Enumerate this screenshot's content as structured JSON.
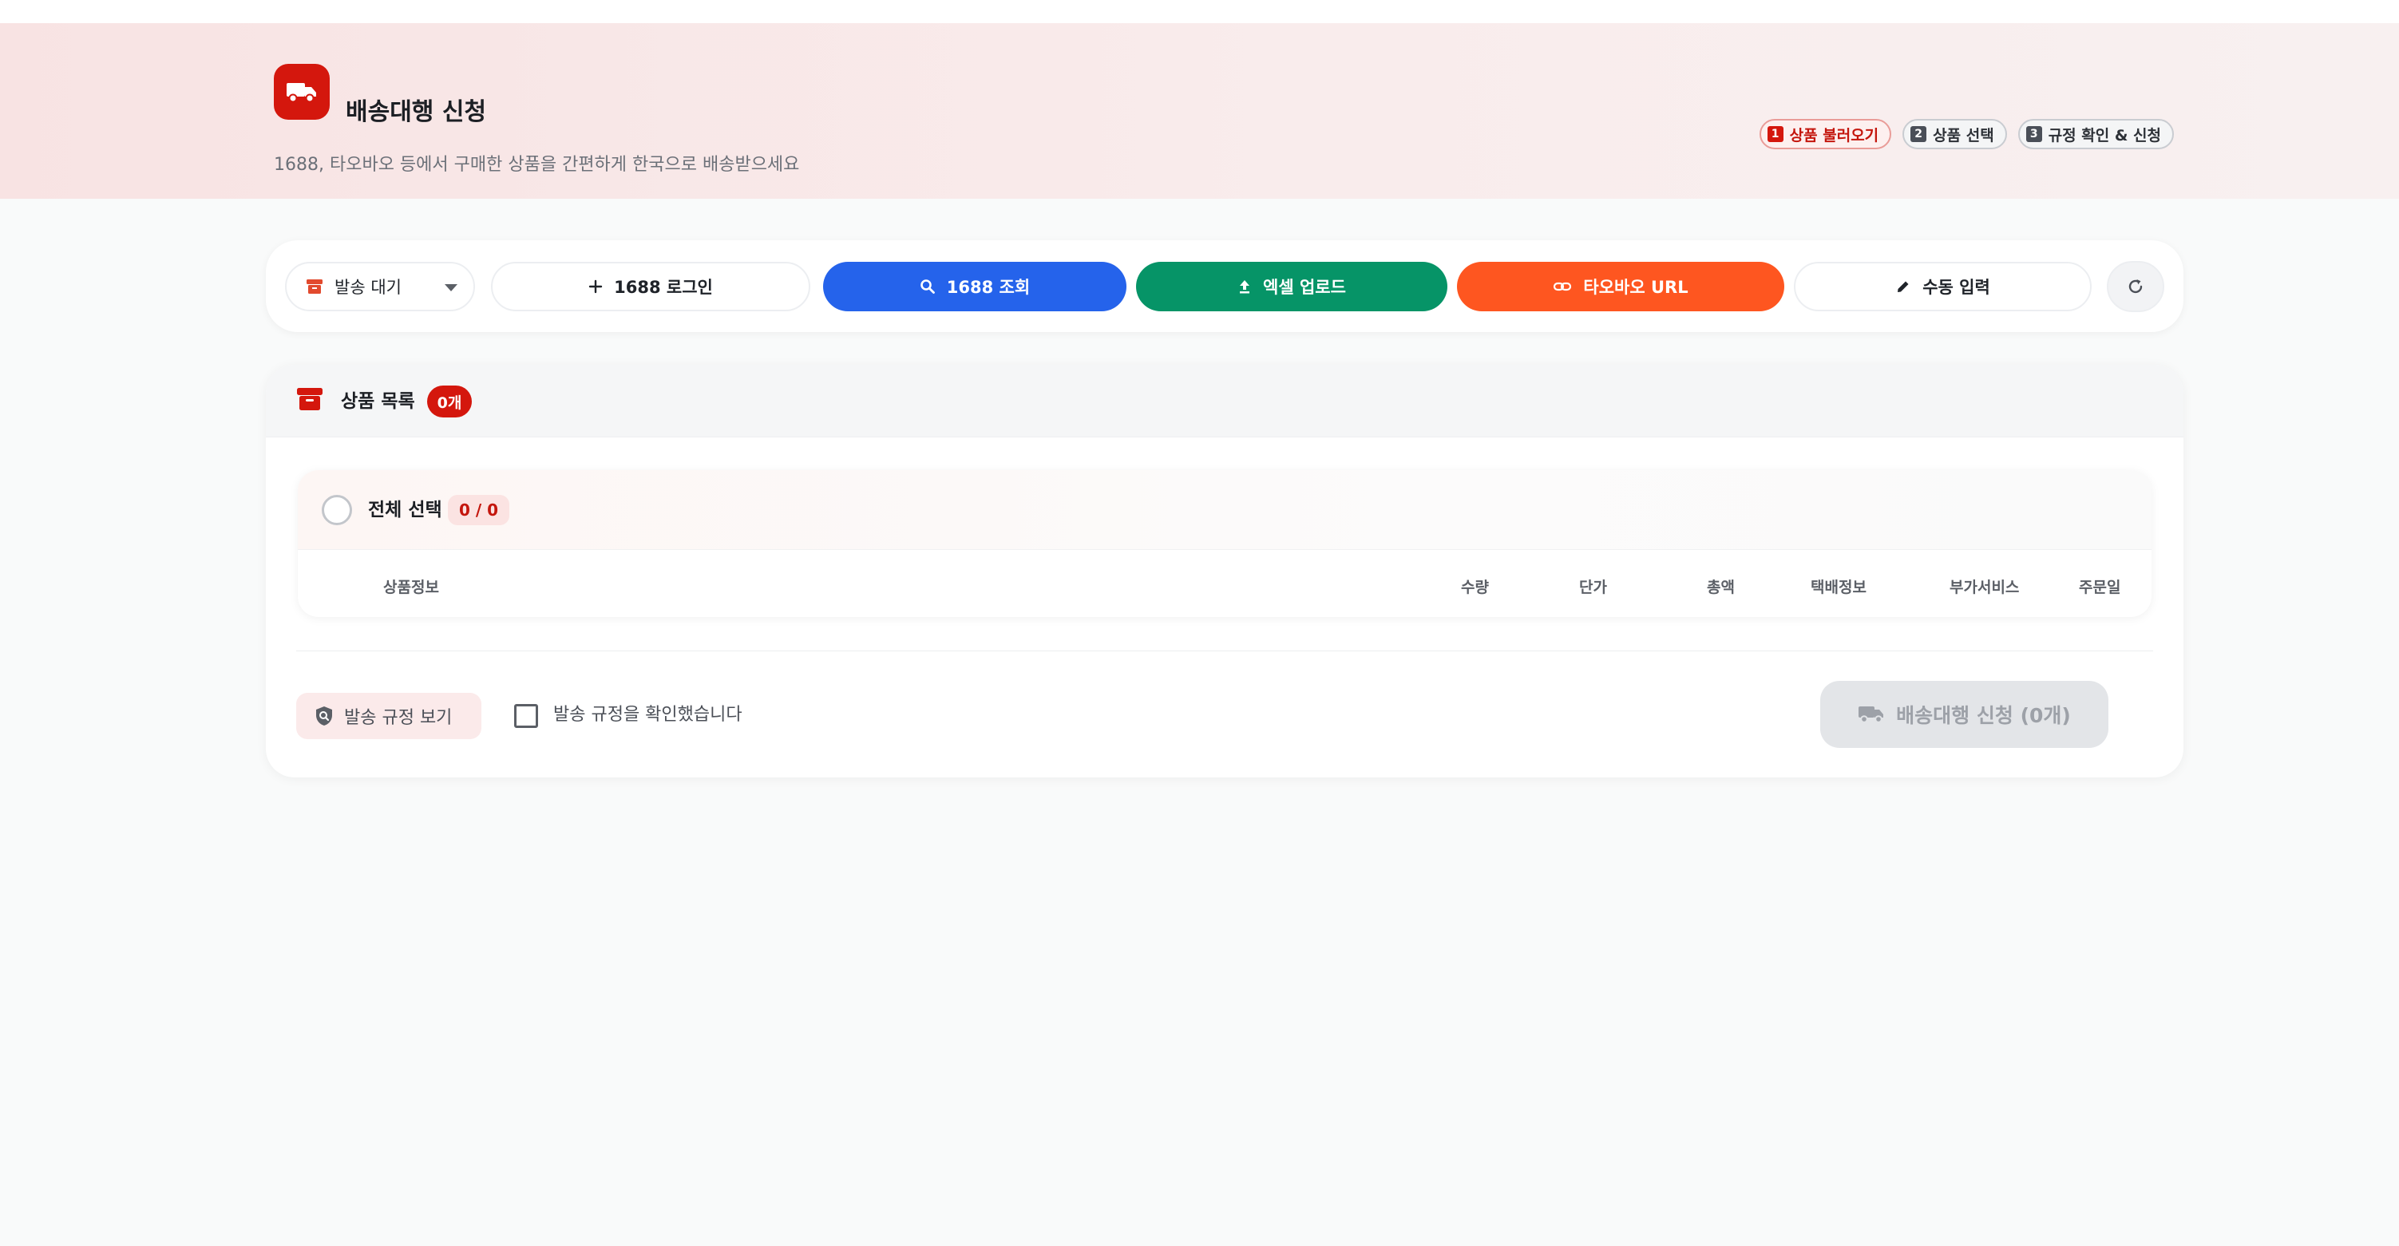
{
  "header": {
    "title": "배송대행 신청",
    "subtitle": "1688, 타오바오 등에서 구매한 상품을 간편하게 한국으로 배송받으세요",
    "steps": [
      {
        "num": "1",
        "label": "상품 불러오기",
        "active": true
      },
      {
        "num": "2",
        "label": "상품 선택",
        "active": false
      },
      {
        "num": "3",
        "label": "규정 확인 & 신청",
        "active": false
      }
    ]
  },
  "toolbar": {
    "status_select": "발송 대기",
    "login_label": "1688 로그인",
    "search_label": "1688 조회",
    "excel_label": "엑셀 업로드",
    "taobao_label": "타오바오 URL",
    "manual_label": "수동 입력"
  },
  "product_list": {
    "title": "상품 목록",
    "count": "0개",
    "select_all": "전체 선택",
    "selected_count": "0 / 0",
    "columns": [
      "상품정보",
      "수량",
      "단가",
      "총액",
      "택배정보",
      "부가서비스",
      "주문일"
    ]
  },
  "footer": {
    "rules_button": "발송 규정 보기",
    "confirm_label": "발송 규정을 확인했습니다",
    "submit_label": "배송대행 신청 (0개)"
  },
  "colors": {
    "brand": "#d4170d",
    "search": "#2563eb",
    "excel": "#069467",
    "taobao": "#fe5620"
  }
}
